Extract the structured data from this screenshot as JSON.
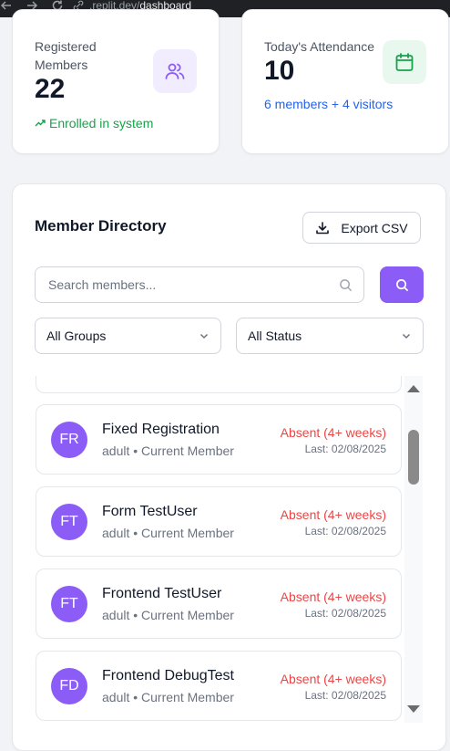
{
  "browser": {
    "url_domain": ".replit.dev/",
    "url_path": "dashboard"
  },
  "stats": {
    "registered": {
      "label_line1": "Registered",
      "label_line2": "Members",
      "value": "22",
      "foot": "Enrolled in system"
    },
    "attendance": {
      "label": "Today's Attendance",
      "value": "10",
      "foot": "6 members + 4 visitors"
    }
  },
  "directory": {
    "title": "Member Directory",
    "export_label": "Export CSV",
    "search_placeholder": "Search members...",
    "group_filter": "All Groups",
    "status_filter": "All Status",
    "members": [
      {
        "initials": "FR",
        "name": "Fixed Registration",
        "sub": "adult • Current Member",
        "status": "Absent (4+ weeks)",
        "last": "Last: 02/08/2025"
      },
      {
        "initials": "FT",
        "name": "Form TestUser",
        "sub": "adult • Current Member",
        "status": "Absent (4+ weeks)",
        "last": "Last: 02/08/2025"
      },
      {
        "initials": "FT",
        "name": "Frontend TestUser",
        "sub": "adult • Current Member",
        "status": "Absent (4+ weeks)",
        "last": "Last: 02/08/2025"
      },
      {
        "initials": "FD",
        "name": "Frontend DebugTest",
        "sub": "adult • Current Member",
        "status": "Absent (4+ weeks)",
        "last": "Last: 02/08/2025"
      }
    ]
  },
  "colors": {
    "accent": "#8b5cf6",
    "success": "#16a34a",
    "link": "#2563eb",
    "danger": "#ef4444"
  },
  "icons": {
    "members": "users-icon",
    "attendance": "calendar-icon",
    "export": "download-icon",
    "search": "search-icon"
  }
}
